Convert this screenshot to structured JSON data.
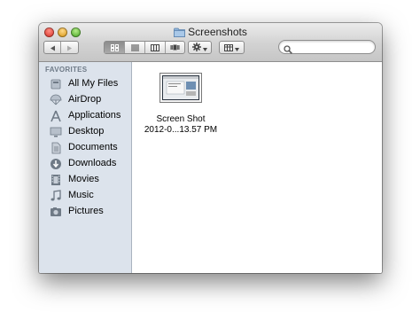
{
  "window": {
    "title": "Screenshots",
    "title_icon": "folder-icon"
  },
  "toolbar": {
    "back_icon": "back-arrow-icon",
    "forward_icon": "forward-arrow-icon",
    "view_modes": [
      "icon-view",
      "list-view",
      "column-view",
      "coverflow-view"
    ],
    "active_view": "icon-view",
    "action_icon": "gear-icon",
    "arrange_icon": "arrange-grid-icon",
    "search_placeholder": ""
  },
  "sidebar": {
    "header": "FAVORITES",
    "items": [
      {
        "label": "All My Files",
        "icon": "all-files-icon"
      },
      {
        "label": "AirDrop",
        "icon": "airdrop-icon"
      },
      {
        "label": "Applications",
        "icon": "applications-icon"
      },
      {
        "label": "Desktop",
        "icon": "desktop-icon"
      },
      {
        "label": "Documents",
        "icon": "documents-icon"
      },
      {
        "label": "Downloads",
        "icon": "downloads-icon"
      },
      {
        "label": "Movies",
        "icon": "movies-icon"
      },
      {
        "label": "Music",
        "icon": "music-icon"
      },
      {
        "label": "Pictures",
        "icon": "pictures-icon"
      }
    ]
  },
  "files": [
    {
      "name_line1": "Screen Shot",
      "name_line2": "2012-0...13.57 PM"
    }
  ],
  "colors": {
    "sidebar_bg": "#dce3ec",
    "sidebar_header": "#6f7b88",
    "titlebar_top": "#ebebeb",
    "titlebar_bottom": "#c6c6c6"
  }
}
